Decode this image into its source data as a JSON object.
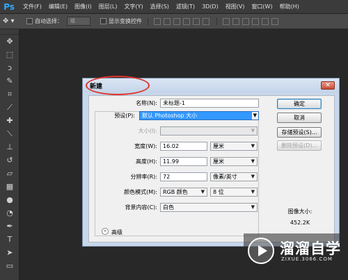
{
  "app": {
    "logo": "Ps"
  },
  "menu": [
    "文件(F)",
    "编辑(E)",
    "图像(I)",
    "图层(L)",
    "文字(Y)",
    "选择(S)",
    "滤镜(T)",
    "3D(D)",
    "视图(V)",
    "窗口(W)",
    "帮助(H)"
  ],
  "options_bar": {
    "tool_icon": "move-tool-icon",
    "auto_select_label": "自动选择：",
    "auto_select_value": "组",
    "show_transform_label": "显示变换控件"
  },
  "tools": [
    "move",
    "marquee",
    "lasso",
    "quick-select",
    "crop",
    "eyedropper",
    "healing",
    "brush",
    "clone-stamp",
    "history-brush",
    "eraser",
    "gradient",
    "blur",
    "dodge",
    "pen",
    "type",
    "path-select",
    "shape"
  ],
  "dialog": {
    "title": "新建",
    "close_glyph": "✕",
    "name_label": "名称(N):",
    "name_value": "未标题-1",
    "preset_label": "预设(P):",
    "preset_value": "默认 Photoshop 大小",
    "size_label": "大小(I):",
    "size_value": "",
    "width_label": "宽度(W):",
    "width_value": "16.02",
    "width_unit": "厘米",
    "height_label": "高度(H):",
    "height_value": "11.99",
    "height_unit": "厘米",
    "resolution_label": "分辨率(R):",
    "resolution_value": "72",
    "resolution_unit": "像素/英寸",
    "color_mode_label": "颜色模式(M):",
    "color_mode_value": "RGB 颜色",
    "bit_depth_value": "8 位",
    "background_label": "背景内容(C):",
    "background_value": "白色",
    "advanced_label": "高级",
    "advanced_glyph": "»",
    "buttons": {
      "ok": "确定",
      "cancel": "取消",
      "save_preset": "存储预设(S)...",
      "delete_preset": "删除预设(D)..."
    },
    "image_size_label": "图像大小:",
    "image_size_value": "452.2K"
  },
  "watermark": {
    "text": "溜溜自学",
    "sub": "ZIXUE.3066.COM"
  },
  "colors": {
    "highlight": "#3399ff",
    "annotation_ellipse": "#e0342a"
  }
}
